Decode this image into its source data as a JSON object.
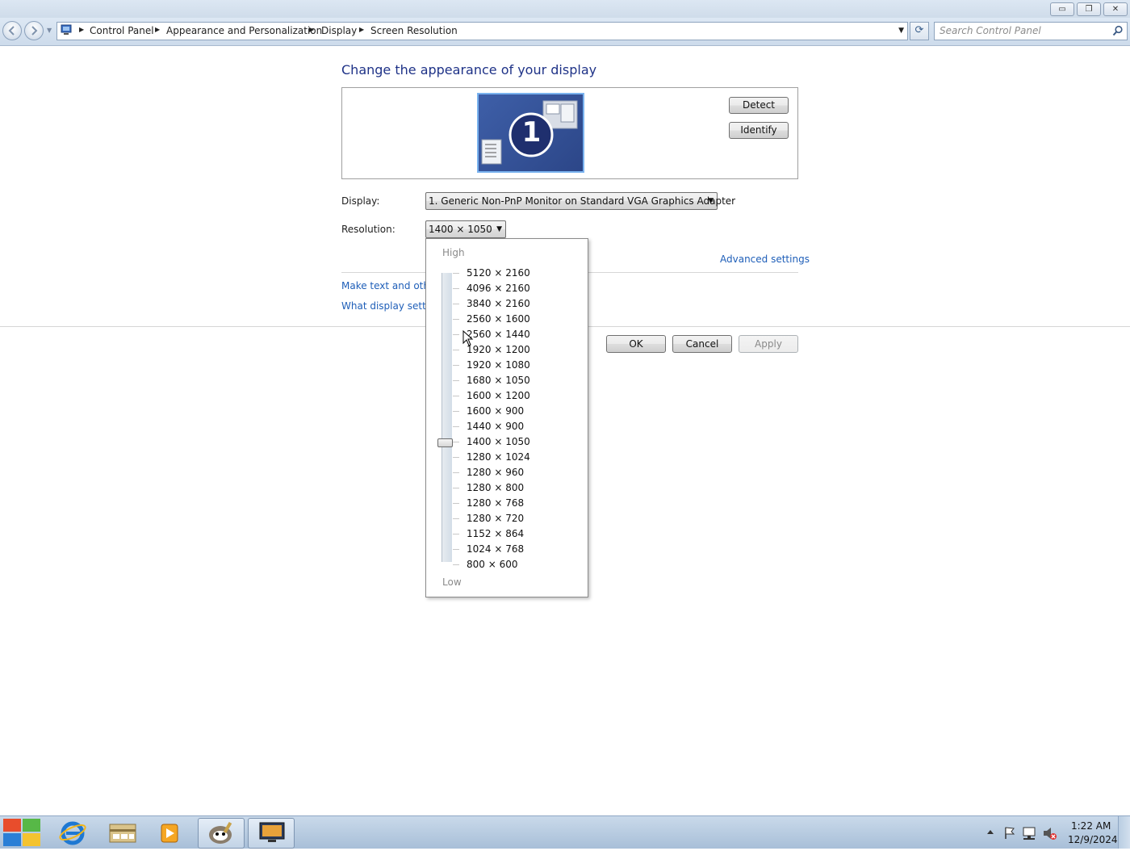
{
  "window": {
    "min_glyph": "▭",
    "max_glyph": "❐",
    "close_glyph": "✕"
  },
  "address": {
    "breadcrumbs": [
      "Control Panel",
      "Appearance and Personalization",
      "Display",
      "Screen Resolution"
    ],
    "separator_glyph": "▶",
    "dropdown_glyph": "▼",
    "refresh_glyph": "⟳"
  },
  "search": {
    "placeholder": "Search Control Panel"
  },
  "main": {
    "title": "Change the appearance of your display",
    "monitor_number": "1",
    "detect_label": "Detect",
    "identify_label": "Identify",
    "display_label": "Display:",
    "display_value": "1. Generic Non-PnP Monitor on Standard VGA Graphics Adapter",
    "resolution_label": "Resolution:",
    "resolution_value": "1400 × 1050",
    "advanced_settings": "Advanced settings",
    "make_text_link": "Make text and other",
    "what_display_link": "What display setting",
    "ok_label": "OK",
    "cancel_label": "Cancel",
    "apply_label": "Apply",
    "dropdown_arrow": "▼"
  },
  "resolution_dropdown": {
    "high_label": "High",
    "low_label": "Low",
    "selected": "1400 × 1050",
    "options": [
      "5120 × 2160",
      "4096 × 2160",
      "3840 × 2160",
      "2560 × 1600",
      "2560 × 1440",
      "1920 × 1200",
      "1920 × 1080",
      "1680 × 1050",
      "1600 × 1200",
      "1600 × 900",
      "1440 × 900",
      "1400 × 1050",
      "1280 × 1024",
      "1280 × 960",
      "1280 × 800",
      "1280 × 768",
      "1280 × 720",
      "1152 × 864",
      "1024 × 768",
      "800 × 600"
    ]
  },
  "taskbar": {
    "apps": [
      "start-orb",
      "internet-explorer",
      "windows-explorer",
      "media-player",
      "gimp",
      "display-control-panel"
    ],
    "tray_icons": [
      "show-hidden-icons",
      "action-center-flag",
      "network-icon",
      "volume-muted-icon"
    ],
    "time": "1:22 AM",
    "date": "12/9/2024"
  },
  "colors": {
    "title_blue": "#1e3287",
    "link_blue": "#1e5eb8",
    "monitor_fill": "#2c4688"
  }
}
